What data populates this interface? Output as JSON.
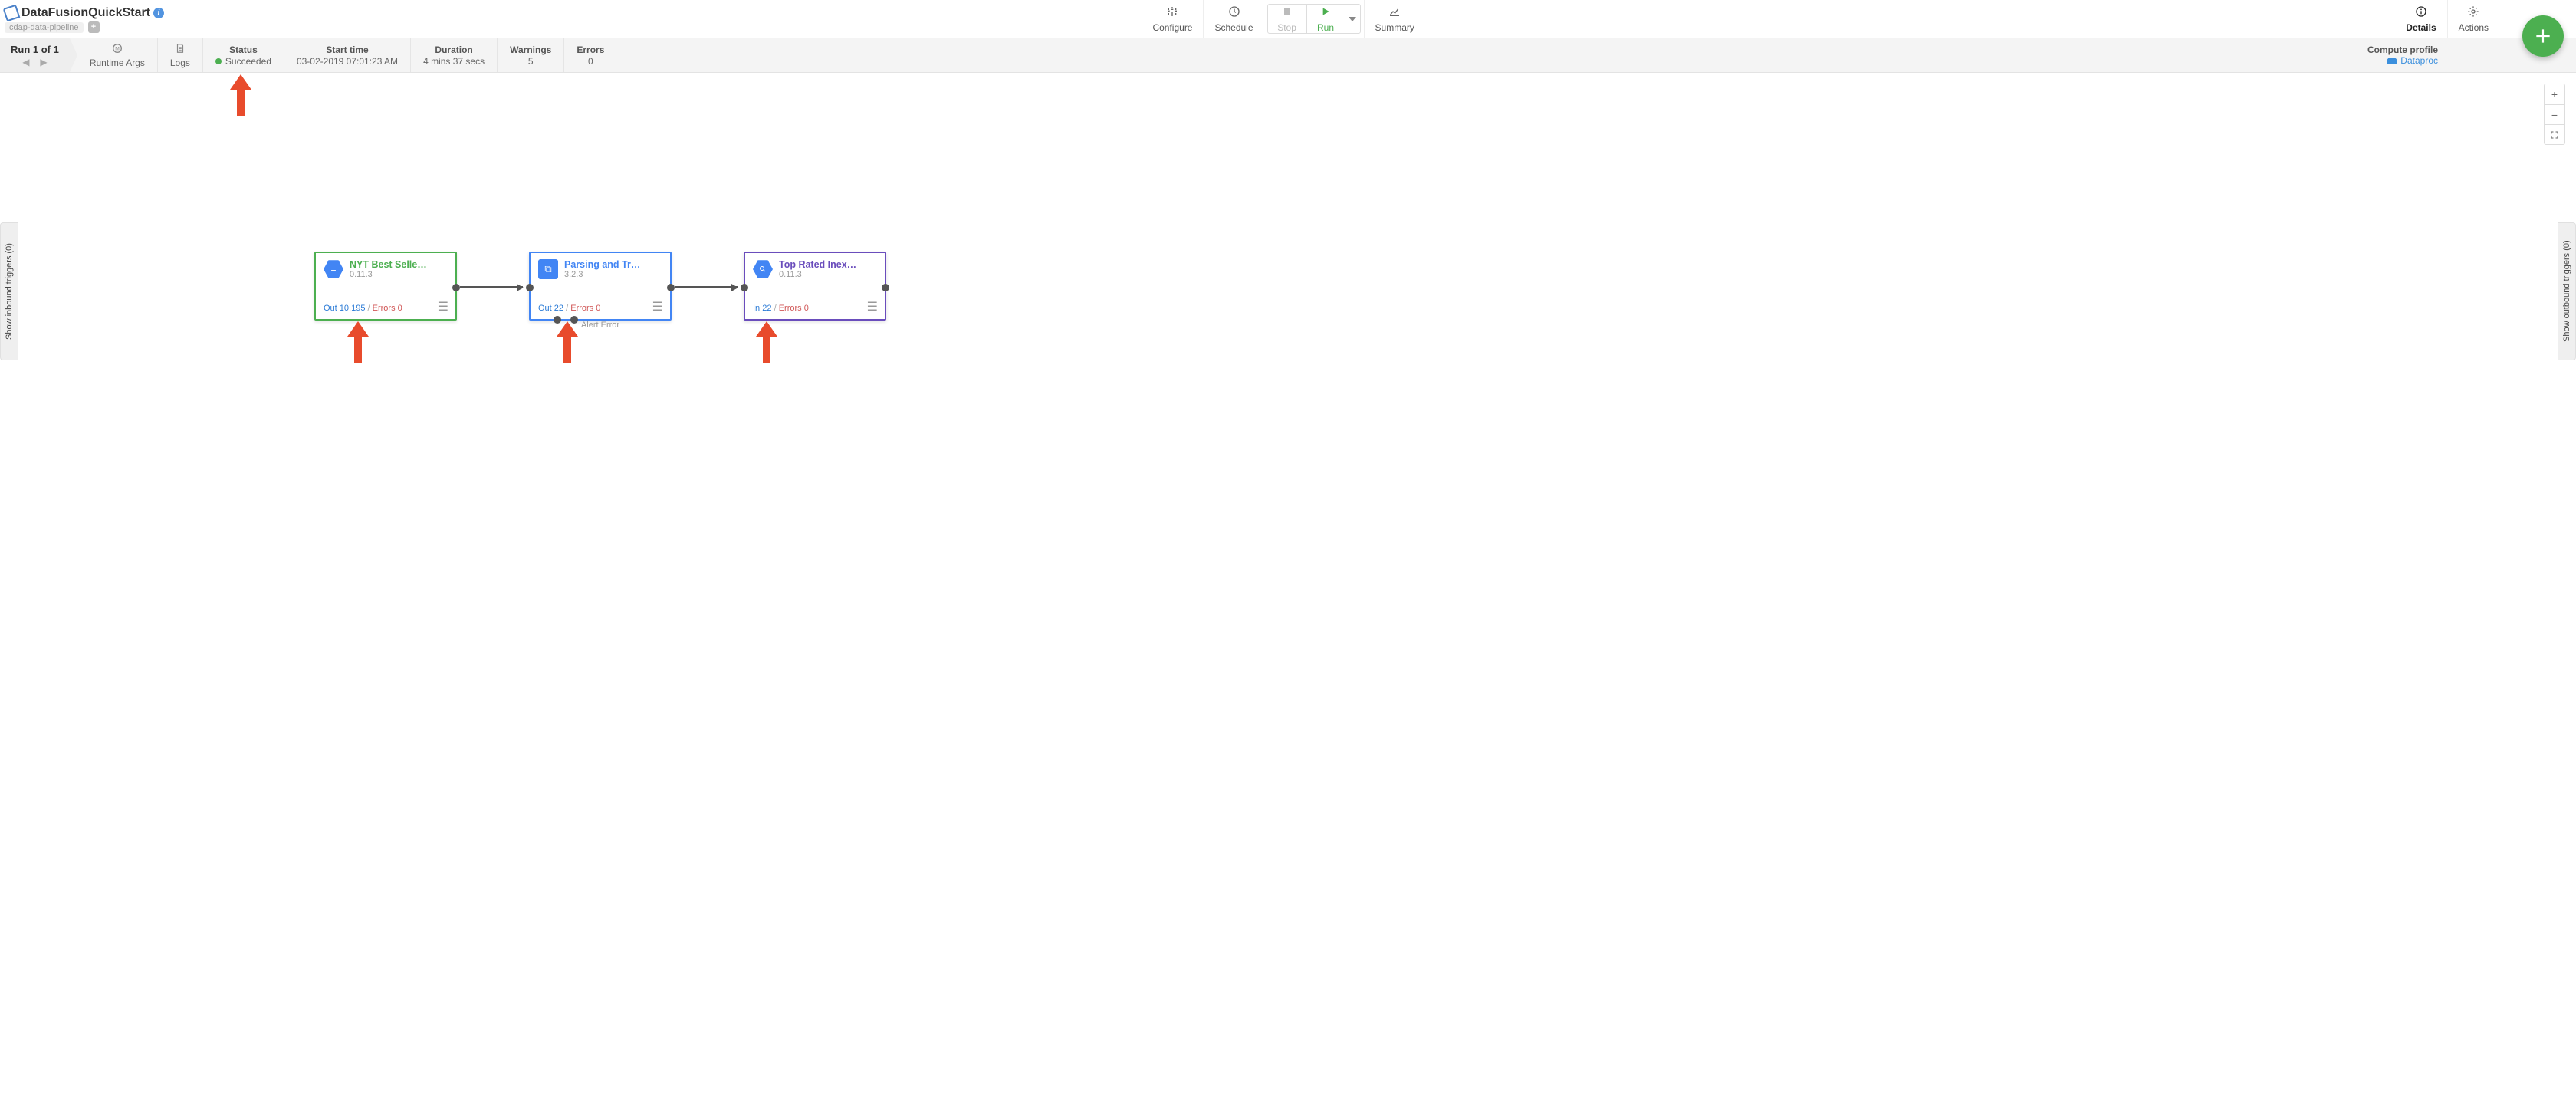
{
  "header": {
    "app_title": "DataFusionQuickStart",
    "pipeline_type": "cdap-data-pipeline"
  },
  "toolbar": {
    "configure": "Configure",
    "schedule": "Schedule",
    "stop": "Stop",
    "run": "Run",
    "summary": "Summary",
    "details": "Details",
    "actions": "Actions"
  },
  "run_strip": {
    "title": "Run 1 of 1",
    "runtime_args": "Runtime Args",
    "logs": "Logs",
    "status_label": "Status",
    "status_value": "Succeeded",
    "start_label": "Start time",
    "start_value": "03-02-2019 07:01:23 AM",
    "duration_label": "Duration",
    "duration_value": "4 mins 37 secs",
    "warnings_label": "Warnings",
    "warnings_value": "5",
    "errors_label": "Errors",
    "errors_value": "0",
    "compute_label": "Compute profile",
    "compute_value": "Dataproc"
  },
  "side_tabs": {
    "inbound": "Show inbound triggers (0)",
    "outbound": "Show outbound triggers (0)"
  },
  "nodes": [
    {
      "title": "NYT Best Selle…",
      "version": "0.11.3",
      "stats_left_label": "Out",
      "stats_left_value": "10,195",
      "stats_errors_label": "Errors",
      "stats_errors_value": "0",
      "border_color": "#4caf50",
      "title_class": "green",
      "icon_type": "hex",
      "has_alert_error": false
    },
    {
      "title": "Parsing and Tr…",
      "version": "3.2.3",
      "stats_left_label": "Out",
      "stats_left_value": "22",
      "stats_errors_label": "Errors",
      "stats_errors_value": "0",
      "alert_text": "Alert    Error",
      "border_color": "#4285f4",
      "title_class": "blue",
      "icon_type": "sq",
      "has_alert_error": true
    },
    {
      "title": "Top Rated Inex…",
      "version": "0.11.3",
      "stats_left_label": "In",
      "stats_left_value": "22",
      "stats_errors_label": "Errors",
      "stats_errors_value": "0",
      "border_color": "#6a4dbc",
      "title_class": "purple",
      "icon_type": "hex",
      "has_alert_error": false
    }
  ]
}
